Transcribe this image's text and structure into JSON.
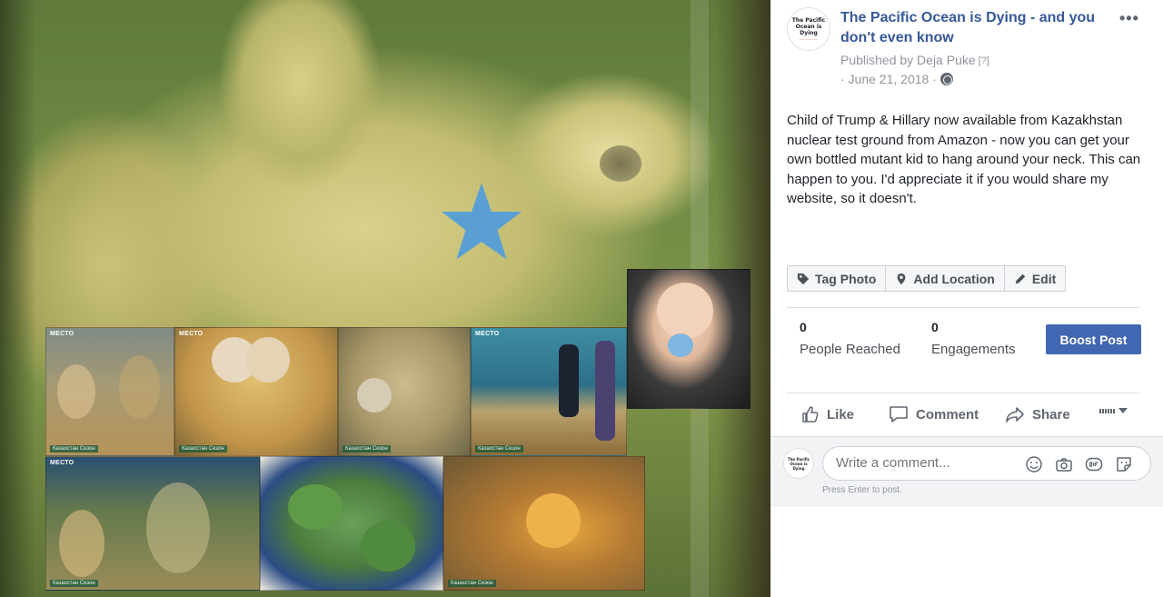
{
  "post": {
    "page_name": "The Pacific Ocean is Dying - and you don't even know",
    "avatar_text": [
      "The Pacific",
      "Ocean is Dying"
    ],
    "published_label": "Published by Deja Puke",
    "published_help": "[?]",
    "date": "· June 21, 2018 ·",
    "body": "Child of Trump & Hillary now available from Kazakhstan nuclear test ground from Amazon - now you can get your own bottled mutant kid to hang around your neck. This can happen to you. I'd appreciate it if you would share my website, so it doesn't."
  },
  "photo_actions": {
    "tag": "Tag Photo",
    "location": "Add Location",
    "edit": "Edit"
  },
  "insights": {
    "people_reached_value": "0",
    "people_reached_label": "People Reached",
    "engagements_value": "0",
    "engagements_label": "Engagements",
    "boost_label": "Boost Post"
  },
  "actions": {
    "like": "Like",
    "comment": "Comment",
    "share": "Share"
  },
  "comment": {
    "placeholder": "Write a comment...",
    "hint": "Press Enter to post."
  },
  "photo": {
    "tv_logo": "МЕСТО",
    "tv_caption": "Казахстан Сезон"
  },
  "colors": {
    "link_blue": "#365899",
    "button_blue": "#4267b2",
    "star_blue": "#5a9fd4"
  },
  "icons": [
    "more-icon",
    "globe-icon",
    "tag-icon",
    "location-pin-icon",
    "pencil-icon",
    "thumbs-up-icon",
    "comment-bubble-icon",
    "share-arrow-icon",
    "reaction-selector-icon",
    "emoji-icon",
    "camera-icon",
    "gif-icon",
    "sticker-icon"
  ]
}
